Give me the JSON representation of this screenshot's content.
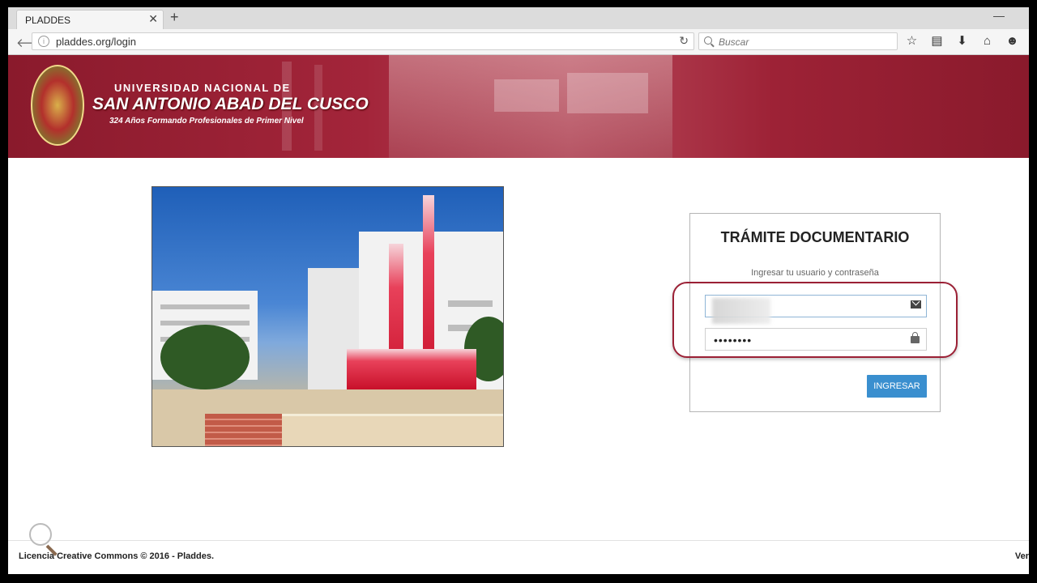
{
  "browser": {
    "tab_title": "PLADDES",
    "tab_close": "✕",
    "new_tab": "+",
    "minimize": "—",
    "back": "🡐",
    "info": "i",
    "url": "pladdes.org/login",
    "reload": "↻",
    "search_placeholder": "Buscar",
    "icons": [
      "star-icon",
      "clipboard-icon",
      "download-icon",
      "home-icon",
      "chat-icon"
    ],
    "icon_glyphs": [
      "☆",
      "▤",
      "⬇",
      "⌂",
      "☻"
    ]
  },
  "banner": {
    "line1": "UNIVERSIDAD NACIONAL DE",
    "line2": "SAN ANTONIO ABAD DEL CUSCO",
    "line3": "324 Años Formando Profesionales de Primer Nivel"
  },
  "login": {
    "title": "TRÁMITE DOCUMENTARIO",
    "subtitle": "Ingresar tu usuario y contraseña",
    "username_value": "",
    "password_value": "••••••••",
    "submit_label": "INGRESAR"
  },
  "footer": {
    "text": "Licencia Creative Commons © 2016 - Pladdes.",
    "right_text": "Ver"
  }
}
